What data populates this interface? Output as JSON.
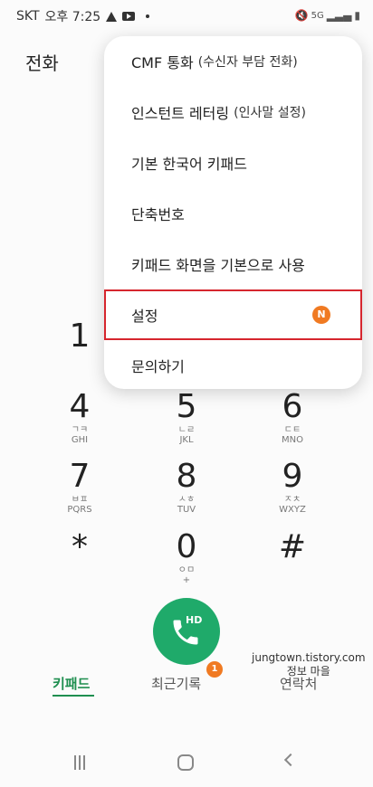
{
  "status_bar": {
    "carrier": "SKT",
    "time": "오후 7:25",
    "network": "5G"
  },
  "app": {
    "title": "전화"
  },
  "menu": {
    "items": [
      {
        "label": "CMF 통화",
        "sub": "(수신자 부담 전화)"
      },
      {
        "label": "인스턴트 레터링",
        "sub": "(인사말 설정)"
      },
      {
        "label": "기본 한국어 키패드",
        "sub": ""
      },
      {
        "label": "단축번호",
        "sub": ""
      },
      {
        "label": "키패드 화면을 기본으로 사용",
        "sub": ""
      },
      {
        "label": "설정",
        "sub": "",
        "badge": "N"
      },
      {
        "label": "문의하기",
        "sub": ""
      }
    ]
  },
  "dialpad": {
    "k1": {
      "num": "1"
    },
    "k4": {
      "num": "4",
      "ko": "ㄱㅋ",
      "en": "GHI"
    },
    "k5": {
      "num": "5",
      "ko": "ㄴㄹ",
      "en": "JKL"
    },
    "k6": {
      "num": "6",
      "ko": "ㄷㅌ",
      "en": "MNO"
    },
    "k7": {
      "num": "7",
      "ko": "ㅂㅍ",
      "en": "PQRS"
    },
    "k8": {
      "num": "8",
      "ko": "ㅅㅎ",
      "en": "TUV"
    },
    "k9": {
      "num": "9",
      "ko": "ㅈㅊ",
      "en": "WXYZ"
    },
    "kstar": {
      "num": "*"
    },
    "k0": {
      "num": "0",
      "ko": "ㅇㅁ",
      "en": "+"
    },
    "khash": {
      "num": "#"
    }
  },
  "call": {
    "hd_label": "HD"
  },
  "watermark": {
    "line1": "jungtown.tistory.com",
    "line2": "정보 마을"
  },
  "tabs": {
    "keypad": "키패드",
    "recents": "최근기록",
    "recents_badge": "1",
    "contacts": "연락처"
  },
  "colors": {
    "accent": "#1f8f50",
    "call": "#1faa6a",
    "badge": "#f07a22",
    "highlight": "#d6262e"
  }
}
